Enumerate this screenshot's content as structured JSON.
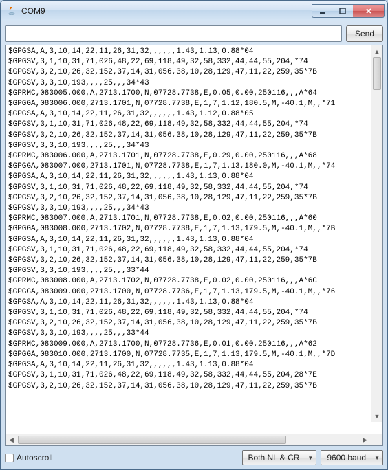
{
  "window": {
    "title": "COM9"
  },
  "toolbar": {
    "send_label": "Send",
    "input_value": ""
  },
  "output_lines": [
    "$GPGSA,A,3,10,14,22,11,26,31,32,,,,,,1.43,1.13,0.88*04",
    "$GPGSV,3,1,10,31,71,026,48,22,69,118,49,32,58,332,44,44,55,204,*74",
    "$GPGSV,3,2,10,26,32,152,37,14,31,056,38,10,28,129,47,11,22,259,35*7B",
    "$GPGSV,3,3,10,193,,,,25,,,34*43",
    "$GPRMC,083005.000,A,2713.1700,N,07728.7738,E,0.05,0.00,250116,,,A*64",
    "$GPGGA,083006.000,2713.1701,N,07728.7738,E,1,7,1.12,180.5,M,-40.1,M,,*71",
    "$GPGSA,A,3,10,14,22,11,26,31,32,,,,,,1.43,1.12,0.88*05",
    "$GPGSV,3,1,10,31,71,026,48,22,69,118,49,32,58,332,44,44,55,204,*74",
    "$GPGSV,3,2,10,26,32,152,37,14,31,056,38,10,28,129,47,11,22,259,35*7B",
    "$GPGSV,3,3,10,193,,,,25,,,34*43",
    "$GPRMC,083006.000,A,2713.1701,N,07728.7738,E,0.29,0.00,250116,,,A*68",
    "$GPGGA,083007.000,2713.1701,N,07728.7738,E,1,7,1.13,180.0,M,-40.1,M,,*74",
    "$GPGSA,A,3,10,14,22,11,26,31,32,,,,,,1.43,1.13,0.88*04",
    "$GPGSV,3,1,10,31,71,026,48,22,69,118,49,32,58,332,44,44,55,204,*74",
    "$GPGSV,3,2,10,26,32,152,37,14,31,056,38,10,28,129,47,11,22,259,35*7B",
    "$GPGSV,3,3,10,193,,,,25,,,34*43",
    "$GPRMC,083007.000,A,2713.1701,N,07728.7738,E,0.02,0.00,250116,,,A*60",
    "$GPGGA,083008.000,2713.1702,N,07728.7738,E,1,7,1.13,179.5,M,-40.1,M,,*7B",
    "$GPGSA,A,3,10,14,22,11,26,31,32,,,,,,1.43,1.13,0.88*04",
    "$GPGSV,3,1,10,31,71,026,48,22,69,118,49,32,58,332,44,44,55,204,*74",
    "$GPGSV,3,2,10,26,32,152,37,14,31,056,38,10,28,129,47,11,22,259,35*7B",
    "$GPGSV,3,3,10,193,,,,25,,,33*44",
    "$GPRMC,083008.000,A,2713.1702,N,07728.7738,E,0.02,0.00,250116,,,A*6C",
    "$GPGGA,083009.000,2713.1700,N,07728.7736,E,1,7,1.13,179.5,M,-40.1,M,,*76",
    "$GPGSA,A,3,10,14,22,11,26,31,32,,,,,,1.43,1.13,0.88*04",
    "$GPGSV,3,1,10,31,71,026,48,22,69,118,49,32,58,332,44,44,55,204,*74",
    "$GPGSV,3,2,10,26,32,152,37,14,31,056,38,10,28,129,47,11,22,259,35*7B",
    "$GPGSV,3,3,10,193,,,,25,,,33*44",
    "$GPRMC,083009.000,A,2713.1700,N,07728.7736,E,0.01,0.00,250116,,,A*62",
    "$GPGGA,083010.000,2713.1700,N,07728.7735,E,1,7,1.13,179.5,M,-40.1,M,,*7D",
    "$GPGSA,A,3,10,14,22,11,26,31,32,,,,,,1.43,1.13,0.88*04",
    "$GPGSV,3,1,10,31,71,026,48,22,69,118,49,32,58,332,44,44,55,204,28*7E",
    "$GPGSV,3,2,10,26,32,152,37,14,31,056,38,10,28,129,47,11,22,259,35*7B"
  ],
  "footer": {
    "autoscroll_label": "Autoscroll",
    "line_ending_selected": "Both NL & CR",
    "baud_selected": "9600 baud"
  }
}
